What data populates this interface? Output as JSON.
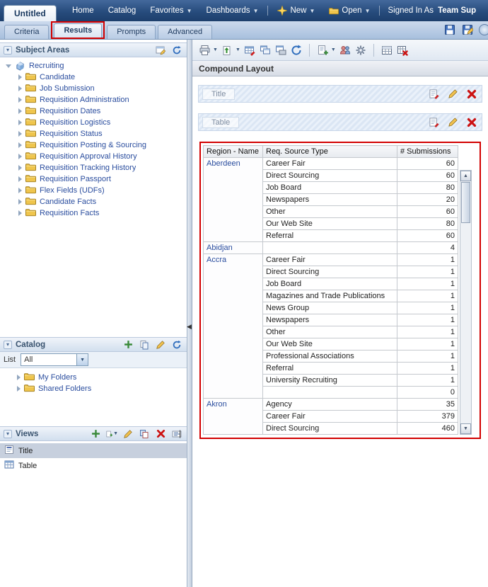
{
  "annotation": {
    "color": "#d20000"
  },
  "header": {
    "title": "Untitled",
    "menu": [
      {
        "label": "Home"
      },
      {
        "label": "Catalog"
      },
      {
        "label": "Favorites"
      },
      {
        "label": "Dashboards"
      }
    ],
    "new_label": "New",
    "open_label": "Open",
    "signed_in_label": "Signed In As",
    "user_name": "Team Sup"
  },
  "tabs": {
    "items": [
      "Criteria",
      "Results",
      "Prompts",
      "Advanced"
    ],
    "active": "Results"
  },
  "subject_areas": {
    "title": "Subject Areas",
    "root": "Recruiting",
    "folders": [
      "Candidate",
      "Job Submission",
      "Requisition Administration",
      "Requisition Dates",
      "Requisition Logistics",
      "Requisition Status",
      "Requisition Posting & Sourcing",
      "Requisition Approval History",
      "Requisition Tracking History",
      "Requisition Passport",
      "Flex Fields (UDFs)",
      "Candidate Facts",
      "Requisition Facts"
    ]
  },
  "catalog": {
    "title": "Catalog",
    "list_label": "List",
    "list_value": "All",
    "folders": [
      "My Folders",
      "Shared Folders"
    ]
  },
  "views": {
    "title": "Views",
    "items": [
      {
        "label": "Title",
        "icon": "title-view-icon",
        "selected": true
      },
      {
        "label": "Table",
        "icon": "table-view-icon",
        "selected": false
      }
    ]
  },
  "main": {
    "compound_layout": "Compound Layout",
    "sections": [
      {
        "label": "Title"
      },
      {
        "label": "Table"
      }
    ]
  },
  "toolbar_icons": [
    "printer-icon",
    "export-icon",
    "table-edit-icon",
    "table-copy-icon",
    "table-print-icon",
    "refresh-icon",
    "new-view-icon",
    "users-icon",
    "properties-icon",
    "grid-icon",
    "grid-delete-icon"
  ],
  "table": {
    "columns": [
      "Region - Name",
      "Req. Source Type",
      "# Submissions"
    ],
    "groups": [
      {
        "region": "Aberdeen",
        "rows": [
          [
            "Career Fair",
            60
          ],
          [
            "Direct Sourcing",
            60
          ],
          [
            "Job Board",
            80
          ],
          [
            "Newspapers",
            20
          ],
          [
            "Other",
            60
          ],
          [
            "Our Web Site",
            80
          ],
          [
            "Referral",
            60
          ]
        ]
      },
      {
        "region": "Abidjan",
        "rows": [
          [
            "",
            4
          ]
        ]
      },
      {
        "region": "Accra",
        "rows": [
          [
            "Career Fair",
            1
          ],
          [
            "Direct Sourcing",
            1
          ],
          [
            "Job Board",
            1
          ],
          [
            "Magazines and Trade Publications",
            1
          ],
          [
            "News Group",
            1
          ],
          [
            "Newspapers",
            1
          ],
          [
            "Other",
            1
          ],
          [
            "Our Web Site",
            1
          ],
          [
            "Professional Associations",
            1
          ],
          [
            "Referral",
            1
          ],
          [
            "University Recruiting",
            1
          ],
          [
            "",
            0
          ]
        ]
      },
      {
        "region": "Akron",
        "rows": [
          [
            "Agency",
            35
          ],
          [
            "Career Fair",
            379
          ],
          [
            "Direct Sourcing",
            460
          ]
        ]
      }
    ]
  }
}
